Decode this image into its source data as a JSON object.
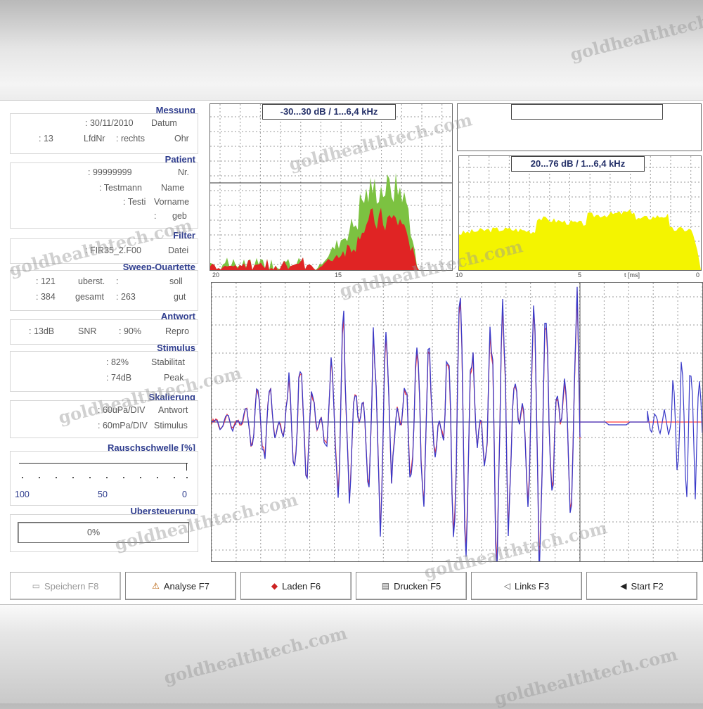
{
  "left_panel": {
    "messung": {
      "title": "Messung",
      "datum_label": "Datum",
      "datum_value": ": 30/11/2010",
      "ohr_label": "Ohr",
      "ohr_value": ": rechts",
      "lfdnr_label": "LfdNr",
      "lfdnr_value": ": 13"
    },
    "patient": {
      "title": "Patient",
      "nr_label": "Nr.",
      "nr_value": ": 99999999",
      "name_label": "Name",
      "name_value": ": Testmann",
      "vorname_label": "Vorname",
      "vorname_value": ": Testi",
      "geb_label": "geb",
      "geb_value": ":"
    },
    "filter": {
      "title": "Filter",
      "datei_label": "Datei",
      "datei_value": ": FIR35_2.F00"
    },
    "sweep": {
      "title": "Sweep-Quartette",
      "soll_label": "soll",
      "soll_value": ":",
      "uberst_label": "uberst.",
      "uberst_value": ": 121",
      "gut_label": "gut",
      "gut_value": ": 263",
      "gesamt_label": "gesamt",
      "gesamt_value": ": 384"
    },
    "antwort": {
      "title": "Antwort",
      "repro_label": "Repro",
      "repro_value": ": 90%",
      "snr_label": "SNR",
      "snr_value": ": 13dB"
    },
    "stimulus": {
      "title": "Stimulus",
      "stabilitat_label": "Stabilitat",
      "stabilitat_value": ": 82%",
      "peak_label": "Peak",
      "peak_value": ": 74dB"
    },
    "skalierung": {
      "title": "Skalierung",
      "antwort_label": "Antwort",
      "antwort_value": ": 60uPa/DIV",
      "stimulus_label": "Stimulus",
      "stimulus_value": ": 60mPa/DIV"
    },
    "rauschschwelle": {
      "title": "Rauschschwelle [%]",
      "scale_left": "100",
      "scale_mid": "50",
      "scale_right": "0",
      "level_percent": 0
    },
    "uebersteuerung": {
      "title": "Ubersteuerung",
      "value": "0%"
    }
  },
  "charts": {
    "spectrum_left_title": "-30...30 dB / 1...6,4 kHz",
    "spectrum_right_title": "20...76 dB / 1...6,4 kHz",
    "time_axis": {
      "labels": [
        "20",
        "15",
        "10",
        "5",
        "0"
      ],
      "unit": "t [ms]"
    }
  },
  "buttons": {
    "speichern": "Speichern F8",
    "analyse": "Analyse F7",
    "laden": "Laden F6",
    "drucken": "Drucken F5",
    "links": "Links F3",
    "start": "Start F2"
  },
  "watermark": "goldhealthtech.com",
  "colors": {
    "title_blue": "#2f3d8e",
    "red": "#e02424",
    "green": "#7cc241",
    "yellow": "#f4f400",
    "trace_blue": "#3a3ac8",
    "trace_red": "#ff3a3a"
  }
}
